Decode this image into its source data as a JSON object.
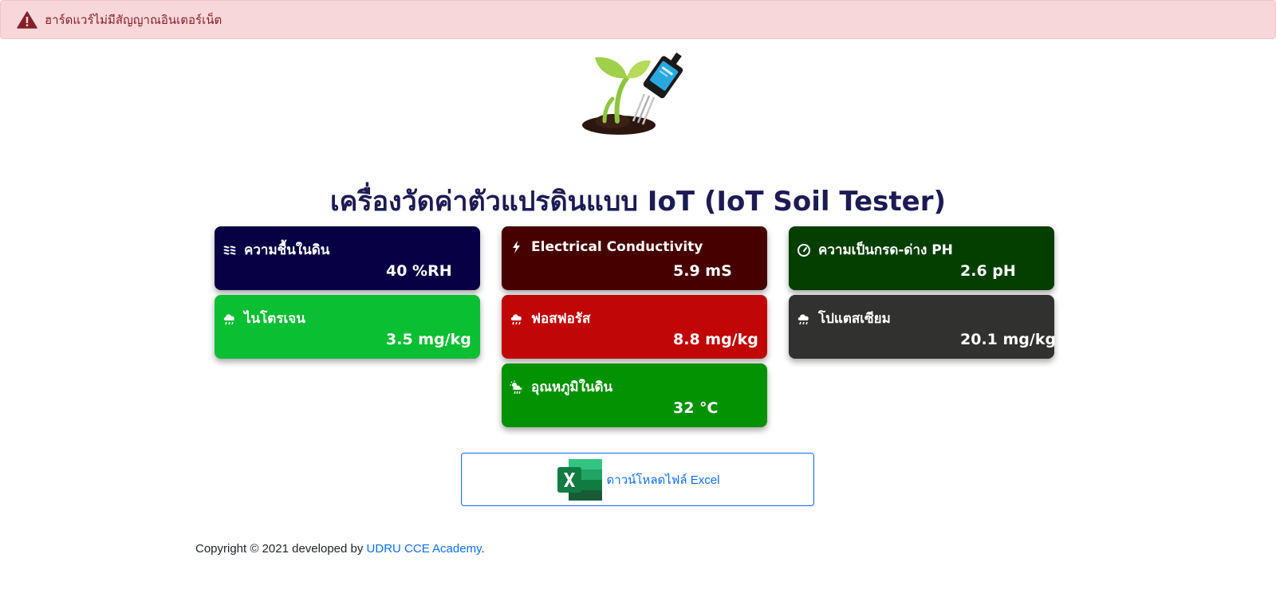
{
  "alert": {
    "text": "ฮาร์ดแวร์ไม่มีสัญญาณอินเตอร์เน็ต",
    "icon": "warning-triangle-icon",
    "color": "#842029",
    "background": "#f8d7da"
  },
  "logo": {
    "icon": "soil-sensor-sprout-logo"
  },
  "title": "เครื่องวัดค่าตัวแปรดินแบบ IoT (IoT Soil Tester)",
  "cards": {
    "moisture": {
      "label": "ความชื้นในดิน",
      "value": "40 %RH",
      "icon": "water-waves-icon",
      "color": "#080045"
    },
    "ec": {
      "label": "Electrical Conductivity",
      "value": "5.9 mS",
      "icon": "lightning-bolt-icon",
      "color": "#470000"
    },
    "ph": {
      "label": "ความเป็นกรด-ด่าง PH",
      "value": "2.6 pH",
      "icon": "speedometer-icon",
      "color": "#043f00"
    },
    "nitrogen": {
      "label": "ไนโตรเจน",
      "value": "3.5 mg/kg",
      "icon": "cloud-rain-icon",
      "color": "#0abf32"
    },
    "phosphorus": {
      "label": "ฟอสฟอรัส",
      "value": "8.8 mg/kg",
      "icon": "cloud-rain-icon",
      "color": "#c10606"
    },
    "potassium": {
      "label": "โปแตสเซียม",
      "value": "20.1 mg/kg",
      "icon": "cloud-rain-icon",
      "color": "#313130"
    },
    "temperature": {
      "label": "อุณหภูมิในดิน",
      "value": "32 °C",
      "icon": "cloud-sun-rain-icon",
      "color": "#039202"
    }
  },
  "download": {
    "label": "ดาวน์โหลดไฟล์ Excel",
    "icon": "excel-icon",
    "color": "#0d6efd"
  },
  "footer": {
    "prefix": "Copyright © 2021 developed by",
    "link_text": "UDRU CCE Academy",
    "suffix": "."
  }
}
